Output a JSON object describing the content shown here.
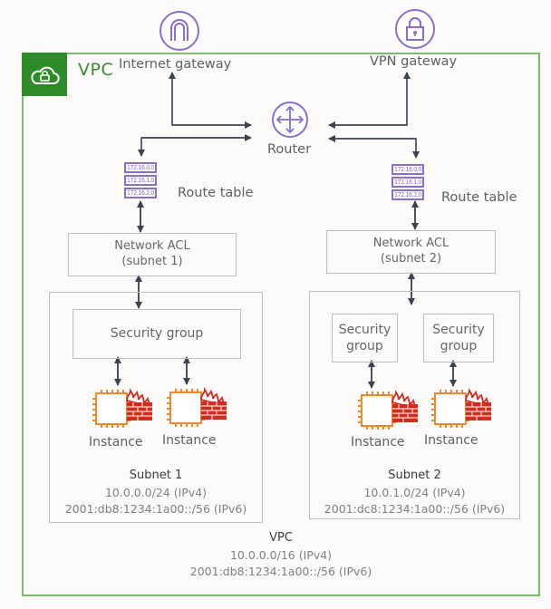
{
  "vpc": {
    "title": "VPC",
    "badge_icon": "cloud-lock-icon",
    "summary": {
      "title": "VPC",
      "ipv4": "10.0.0.0/16 (IPv4)",
      "ipv6": "2001:db8:1234:1a00::/56 (IPv6)"
    }
  },
  "gateways": {
    "internet": {
      "label": "Internet gateway",
      "icon": "internet-gateway-icon"
    },
    "vpn": {
      "label": "VPN gateway",
      "icon": "padlock-icon"
    }
  },
  "router": {
    "label": "Router",
    "icon": "router-arrows-icon"
  },
  "route_tables": [
    {
      "label": "Route table",
      "entries": [
        "172.16.0.0",
        "172.16.1.0",
        "172.16.2.0"
      ]
    },
    {
      "label": "Route table",
      "entries": [
        "172.16.0.0",
        "172.16.1.0",
        "172.16.2.0"
      ]
    }
  ],
  "network_acls": [
    {
      "line1": "Network ACL",
      "line2": "(subnet 1)"
    },
    {
      "line1": "Network ACL",
      "line2": "(subnet 2)"
    }
  ],
  "subnets": [
    {
      "title": "Subnet 1",
      "ipv4": "10.0.0.0/24 (IPv4)",
      "ipv6": "2001:db8:1234:1a00::/56 (IPv6)",
      "security_groups": [
        {
          "label": "Security group"
        }
      ],
      "instances": [
        {
          "label": "Instance"
        },
        {
          "label": "Instance"
        }
      ]
    },
    {
      "title": "Subnet 2",
      "ipv4": "10.0.1.0/24 (IPv4)",
      "ipv6": "2001:dc8:1234:1a00::/56 (IPv6)",
      "security_groups": [
        {
          "line1": "Security",
          "line2": "group"
        },
        {
          "line1": "Security",
          "line2": "group"
        }
      ],
      "instances": [
        {
          "label": "Instance"
        },
        {
          "label": "Instance"
        }
      ]
    }
  ],
  "colors": {
    "vpc_green": "#2e8b2a",
    "vpc_border": "#7cba6e",
    "aws_purple": "#8b6cd0",
    "instance_orange": "#f0892b",
    "firewall_red": "#d62a1e",
    "arrow": "#3d4250"
  }
}
